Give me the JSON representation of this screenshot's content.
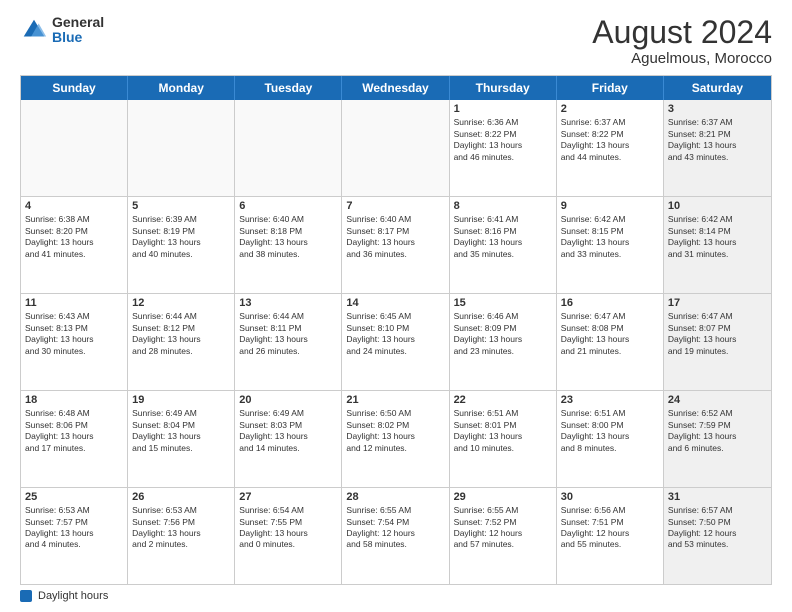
{
  "logo": {
    "general": "General",
    "blue": "Blue"
  },
  "title": "August 2024",
  "subtitle": "Aguelmous, Morocco",
  "days_of_week": [
    "Sunday",
    "Monday",
    "Tuesday",
    "Wednesday",
    "Thursday",
    "Friday",
    "Saturday"
  ],
  "footer_label": "Daylight hours",
  "weeks": [
    [
      {
        "day": "",
        "info": "",
        "empty": true
      },
      {
        "day": "",
        "info": "",
        "empty": true
      },
      {
        "day": "",
        "info": "",
        "empty": true
      },
      {
        "day": "",
        "info": "",
        "empty": true
      },
      {
        "day": "1",
        "info": "Sunrise: 6:36 AM\nSunset: 8:22 PM\nDaylight: 13 hours\nand 46 minutes.",
        "empty": false
      },
      {
        "day": "2",
        "info": "Sunrise: 6:37 AM\nSunset: 8:22 PM\nDaylight: 13 hours\nand 44 minutes.",
        "empty": false
      },
      {
        "day": "3",
        "info": "Sunrise: 6:37 AM\nSunset: 8:21 PM\nDaylight: 13 hours\nand 43 minutes.",
        "empty": false,
        "shaded": true
      }
    ],
    [
      {
        "day": "4",
        "info": "Sunrise: 6:38 AM\nSunset: 8:20 PM\nDaylight: 13 hours\nand 41 minutes.",
        "empty": false
      },
      {
        "day": "5",
        "info": "Sunrise: 6:39 AM\nSunset: 8:19 PM\nDaylight: 13 hours\nand 40 minutes.",
        "empty": false
      },
      {
        "day": "6",
        "info": "Sunrise: 6:40 AM\nSunset: 8:18 PM\nDaylight: 13 hours\nand 38 minutes.",
        "empty": false
      },
      {
        "day": "7",
        "info": "Sunrise: 6:40 AM\nSunset: 8:17 PM\nDaylight: 13 hours\nand 36 minutes.",
        "empty": false
      },
      {
        "day": "8",
        "info": "Sunrise: 6:41 AM\nSunset: 8:16 PM\nDaylight: 13 hours\nand 35 minutes.",
        "empty": false
      },
      {
        "day": "9",
        "info": "Sunrise: 6:42 AM\nSunset: 8:15 PM\nDaylight: 13 hours\nand 33 minutes.",
        "empty": false
      },
      {
        "day": "10",
        "info": "Sunrise: 6:42 AM\nSunset: 8:14 PM\nDaylight: 13 hours\nand 31 minutes.",
        "empty": false,
        "shaded": true
      }
    ],
    [
      {
        "day": "11",
        "info": "Sunrise: 6:43 AM\nSunset: 8:13 PM\nDaylight: 13 hours\nand 30 minutes.",
        "empty": false
      },
      {
        "day": "12",
        "info": "Sunrise: 6:44 AM\nSunset: 8:12 PM\nDaylight: 13 hours\nand 28 minutes.",
        "empty": false
      },
      {
        "day": "13",
        "info": "Sunrise: 6:44 AM\nSunset: 8:11 PM\nDaylight: 13 hours\nand 26 minutes.",
        "empty": false
      },
      {
        "day": "14",
        "info": "Sunrise: 6:45 AM\nSunset: 8:10 PM\nDaylight: 13 hours\nand 24 minutes.",
        "empty": false
      },
      {
        "day": "15",
        "info": "Sunrise: 6:46 AM\nSunset: 8:09 PM\nDaylight: 13 hours\nand 23 minutes.",
        "empty": false
      },
      {
        "day": "16",
        "info": "Sunrise: 6:47 AM\nSunset: 8:08 PM\nDaylight: 13 hours\nand 21 minutes.",
        "empty": false
      },
      {
        "day": "17",
        "info": "Sunrise: 6:47 AM\nSunset: 8:07 PM\nDaylight: 13 hours\nand 19 minutes.",
        "empty": false,
        "shaded": true
      }
    ],
    [
      {
        "day": "18",
        "info": "Sunrise: 6:48 AM\nSunset: 8:06 PM\nDaylight: 13 hours\nand 17 minutes.",
        "empty": false
      },
      {
        "day": "19",
        "info": "Sunrise: 6:49 AM\nSunset: 8:04 PM\nDaylight: 13 hours\nand 15 minutes.",
        "empty": false
      },
      {
        "day": "20",
        "info": "Sunrise: 6:49 AM\nSunset: 8:03 PM\nDaylight: 13 hours\nand 14 minutes.",
        "empty": false
      },
      {
        "day": "21",
        "info": "Sunrise: 6:50 AM\nSunset: 8:02 PM\nDaylight: 13 hours\nand 12 minutes.",
        "empty": false
      },
      {
        "day": "22",
        "info": "Sunrise: 6:51 AM\nSunset: 8:01 PM\nDaylight: 13 hours\nand 10 minutes.",
        "empty": false
      },
      {
        "day": "23",
        "info": "Sunrise: 6:51 AM\nSunset: 8:00 PM\nDaylight: 13 hours\nand 8 minutes.",
        "empty": false
      },
      {
        "day": "24",
        "info": "Sunrise: 6:52 AM\nSunset: 7:59 PM\nDaylight: 13 hours\nand 6 minutes.",
        "empty": false,
        "shaded": true
      }
    ],
    [
      {
        "day": "25",
        "info": "Sunrise: 6:53 AM\nSunset: 7:57 PM\nDaylight: 13 hours\nand 4 minutes.",
        "empty": false
      },
      {
        "day": "26",
        "info": "Sunrise: 6:53 AM\nSunset: 7:56 PM\nDaylight: 13 hours\nand 2 minutes.",
        "empty": false
      },
      {
        "day": "27",
        "info": "Sunrise: 6:54 AM\nSunset: 7:55 PM\nDaylight: 13 hours\nand 0 minutes.",
        "empty": false
      },
      {
        "day": "28",
        "info": "Sunrise: 6:55 AM\nSunset: 7:54 PM\nDaylight: 12 hours\nand 58 minutes.",
        "empty": false
      },
      {
        "day": "29",
        "info": "Sunrise: 6:55 AM\nSunset: 7:52 PM\nDaylight: 12 hours\nand 57 minutes.",
        "empty": false
      },
      {
        "day": "30",
        "info": "Sunrise: 6:56 AM\nSunset: 7:51 PM\nDaylight: 12 hours\nand 55 minutes.",
        "empty": false
      },
      {
        "day": "31",
        "info": "Sunrise: 6:57 AM\nSunset: 7:50 PM\nDaylight: 12 hours\nand 53 minutes.",
        "empty": false,
        "shaded": true
      }
    ]
  ]
}
